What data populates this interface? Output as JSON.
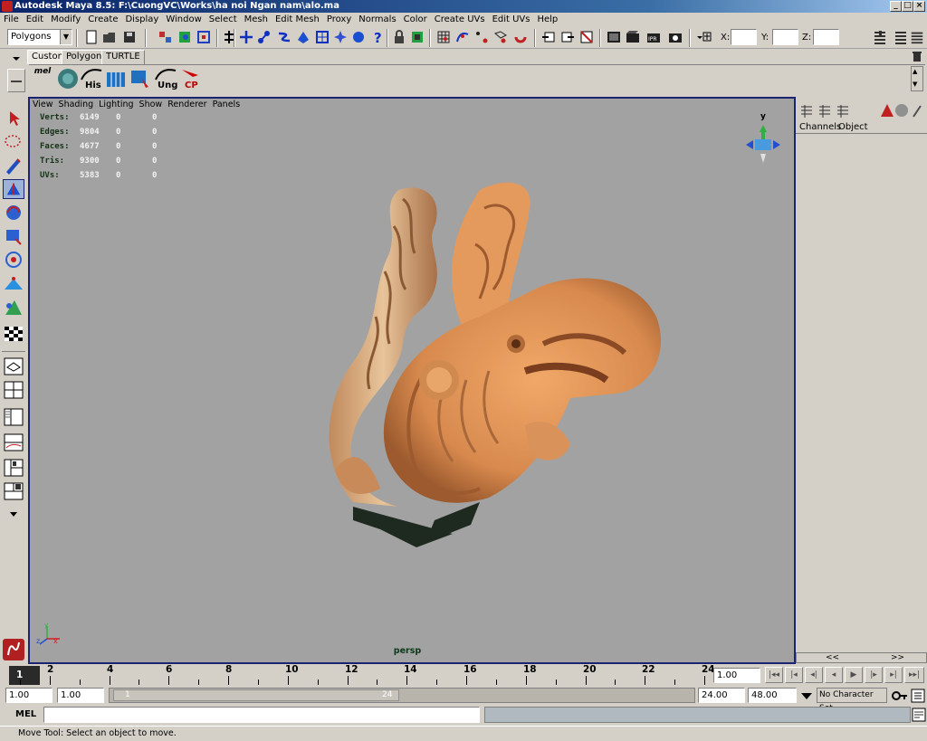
{
  "window": {
    "title": "Autodesk Maya 8.5: F:\\CuongVC\\Works\\ha noi Ngan nam\\alo.ma",
    "controls": [
      "_",
      "□",
      "×"
    ]
  },
  "menubar": [
    "File",
    "Edit",
    "Modify",
    "Create",
    "Display",
    "Window",
    "Select",
    "Mesh",
    "Edit Mesh",
    "Proxy",
    "Normals",
    "Color",
    "Create UVs",
    "Edit UVs",
    "Help"
  ],
  "statusline": {
    "menuset": "Polygons",
    "x_label": "X:",
    "y_label": "Y:",
    "z_label": "Z:"
  },
  "shelf": {
    "tabs": [
      "Custom",
      "Polygons",
      "TURTLE"
    ],
    "active_tab": "Custom",
    "mel_label": "mel",
    "buttons": [
      "His",
      "Ung",
      "CP"
    ]
  },
  "viewport": {
    "menus": [
      "View",
      "Shading",
      "Lighting",
      "Show",
      "Renderer",
      "Panels"
    ],
    "hud": [
      {
        "label": "Verts:",
        "v1": "6149",
        "v2": "0",
        "v3": "0"
      },
      {
        "label": "Edges:",
        "v1": "9804",
        "v2": "0",
        "v3": "0"
      },
      {
        "label": "Faces:",
        "v1": "4677",
        "v2": "0",
        "v3": "0"
      },
      {
        "label": "Tris:",
        "v1": "9300",
        "v2": "0",
        "v3": "0"
      },
      {
        "label": "UVs:",
        "v1": "5383",
        "v2": "0",
        "v3": "0"
      }
    ],
    "camera": "persp",
    "viewcube_axis": "y",
    "axis_labels": {
      "y": "y",
      "x": "x",
      "z": "z"
    }
  },
  "channelbox": {
    "menus": [
      "Channels",
      "Object"
    ],
    "scroll_left": "<<",
    "scroll_right": ">>"
  },
  "timeline": {
    "ticks": [
      "1",
      "2",
      "4",
      "6",
      "8",
      "10",
      "12",
      "14",
      "16",
      "18",
      "20",
      "22",
      "24"
    ],
    "current_time": "1.00",
    "playback": [
      "|◂◂",
      "|◂",
      "◂|",
      "◂",
      "▶",
      "|▸",
      "▸|",
      "▸▸|"
    ]
  },
  "range": {
    "start": "1.00",
    "anim_start": "1.00",
    "slider_start": "1",
    "slider_end": "24",
    "end": "24.00",
    "anim_end": "48.00",
    "character_set": "No Character Set"
  },
  "command": {
    "label": "MEL",
    "value": ""
  },
  "help": {
    "text": "Move Tool: Select an object to move."
  },
  "colors": {
    "viewport_bg": "#a2a2a2",
    "viewport_border": "#1a2470",
    "ui_bg": "#d4d0c8",
    "model": "#e49a5c"
  }
}
